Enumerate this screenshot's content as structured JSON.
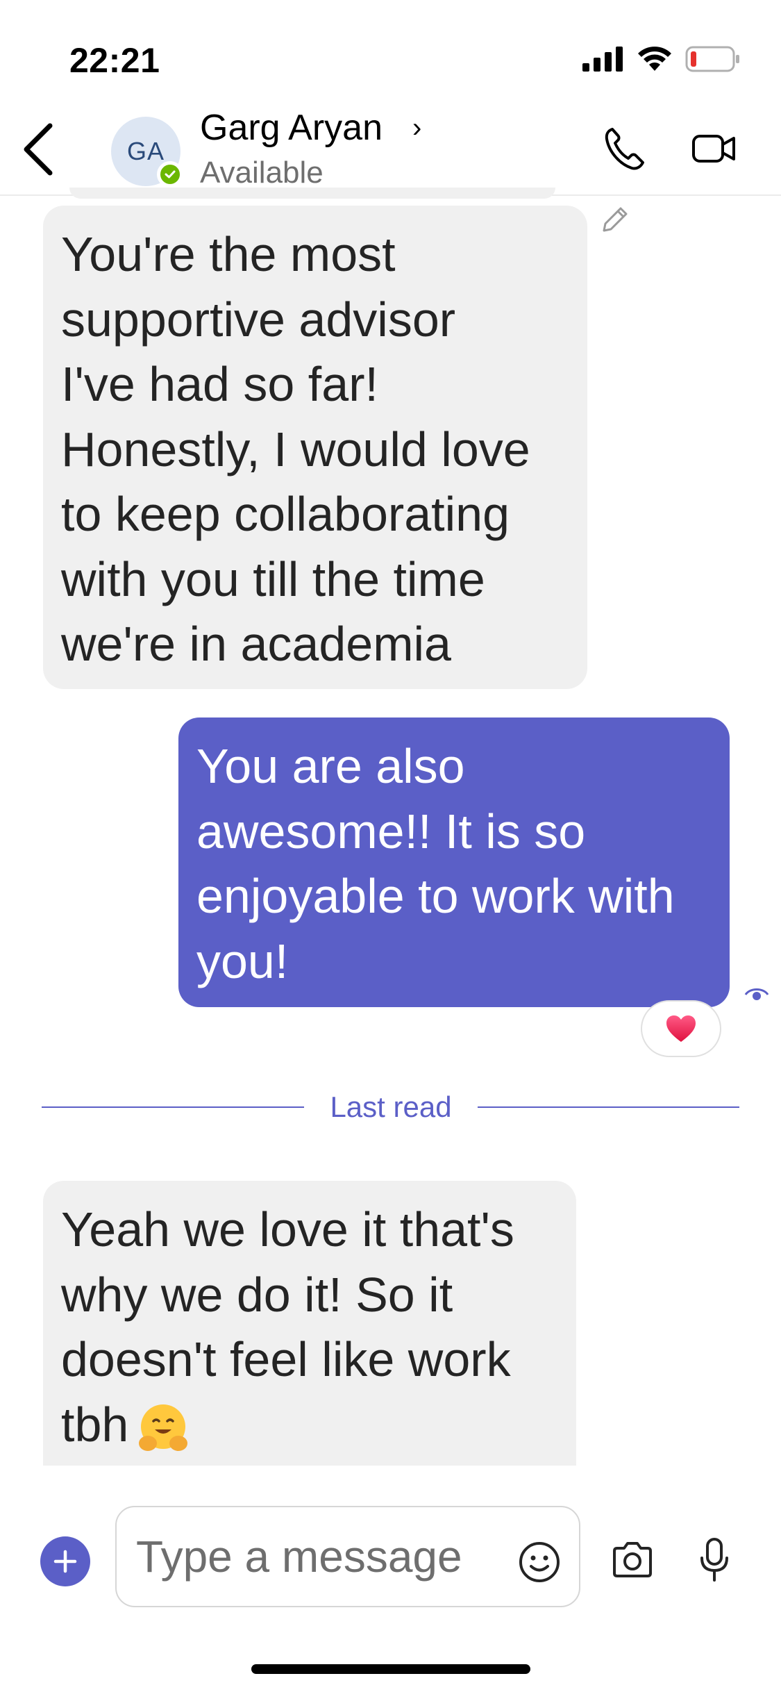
{
  "status_bar": {
    "time": "22:21",
    "icons": [
      "cellular-signal-icon",
      "wifi-icon",
      "battery-low-icon"
    ]
  },
  "header": {
    "back_icon": "chevron-left-icon",
    "avatar_initials": "GA",
    "presence": "available",
    "presence_color": "#6bb700",
    "contact_name": "Garg Aryan",
    "name_chevron": "›",
    "contact_status": "Available",
    "actions": [
      "phone-call-icon",
      "video-call-icon"
    ]
  },
  "messages": [
    {
      "direction": "incoming",
      "text": "You're the most\nsupportive advisor\nI've had so far!\nHonestly, I would love\nto keep collaborating\nwith you till the time\nwe're in academia",
      "edited": true
    },
    {
      "direction": "outgoing",
      "text": "You are also\nawesome!! It is so\nenjoyable to work with\nyou!",
      "reaction": "heart",
      "seen": true
    },
    {
      "direction": "incoming",
      "text": "Yeah we love it that's\nwhy we do it! So it\ndoesn't feel like work\ntbh",
      "emoji": "hugging-face"
    }
  ],
  "last_read_label": "Last read",
  "compose": {
    "placeholder": "Type a message",
    "buttons": [
      "add-icon",
      "emoji-icon",
      "camera-icon",
      "microphone-icon"
    ]
  },
  "colors": {
    "accent": "#5b5fc7",
    "incoming_bubble": "#f0f0f0",
    "outgoing_text": "#ffffff",
    "secondary_text": "#6e6e6e"
  }
}
